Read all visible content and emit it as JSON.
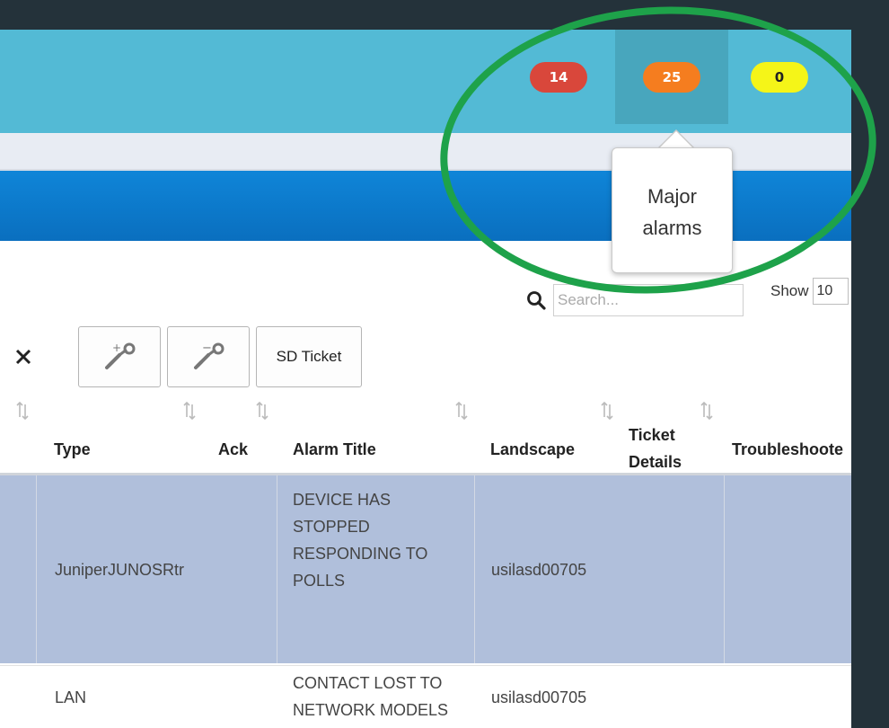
{
  "header": {
    "badges": [
      {
        "name": "critical",
        "count": "14",
        "color": "#d9473b"
      },
      {
        "name": "major",
        "count": "25",
        "color": "#f57d1f"
      },
      {
        "name": "minor",
        "count": "0",
        "color": "#f5f518",
        "text_color": "#222222"
      }
    ]
  },
  "tooltip": {
    "text": "Major alarms"
  },
  "search": {
    "placeholder": "Search..."
  },
  "show": {
    "label": "Show",
    "value": "10"
  },
  "toolbar": {
    "close_icon": "close-icon",
    "add_maintenance_icon": "wrench-add-icon",
    "remove_maintenance_icon": "wrench-remove-icon",
    "sd_ticket_label": "SD Ticket"
  },
  "table": {
    "columns": [
      "Type",
      "Ack",
      "Alarm Title",
      "Landscape",
      "Ticket Details",
      "Troubleshoote"
    ],
    "rows": [
      {
        "type": "JuniperJUNOSRtr",
        "ack": "",
        "alarm_title": "DEVICE HAS STOPPED RESPONDING TO POLLS",
        "landscape": "usilasd00705",
        "ticket_details": "",
        "troubleshooter": ""
      },
      {
        "type": "LAN",
        "ack": "",
        "alarm_title": "CONTACT LOST TO NETWORK MODELS",
        "landscape": "usilasd00705",
        "ticket_details": "",
        "troubleshooter": ""
      }
    ]
  },
  "colors": {
    "highlight": "#1ea24a",
    "header_bg": "#53bad5",
    "selected_row": "#b0bfdb"
  }
}
